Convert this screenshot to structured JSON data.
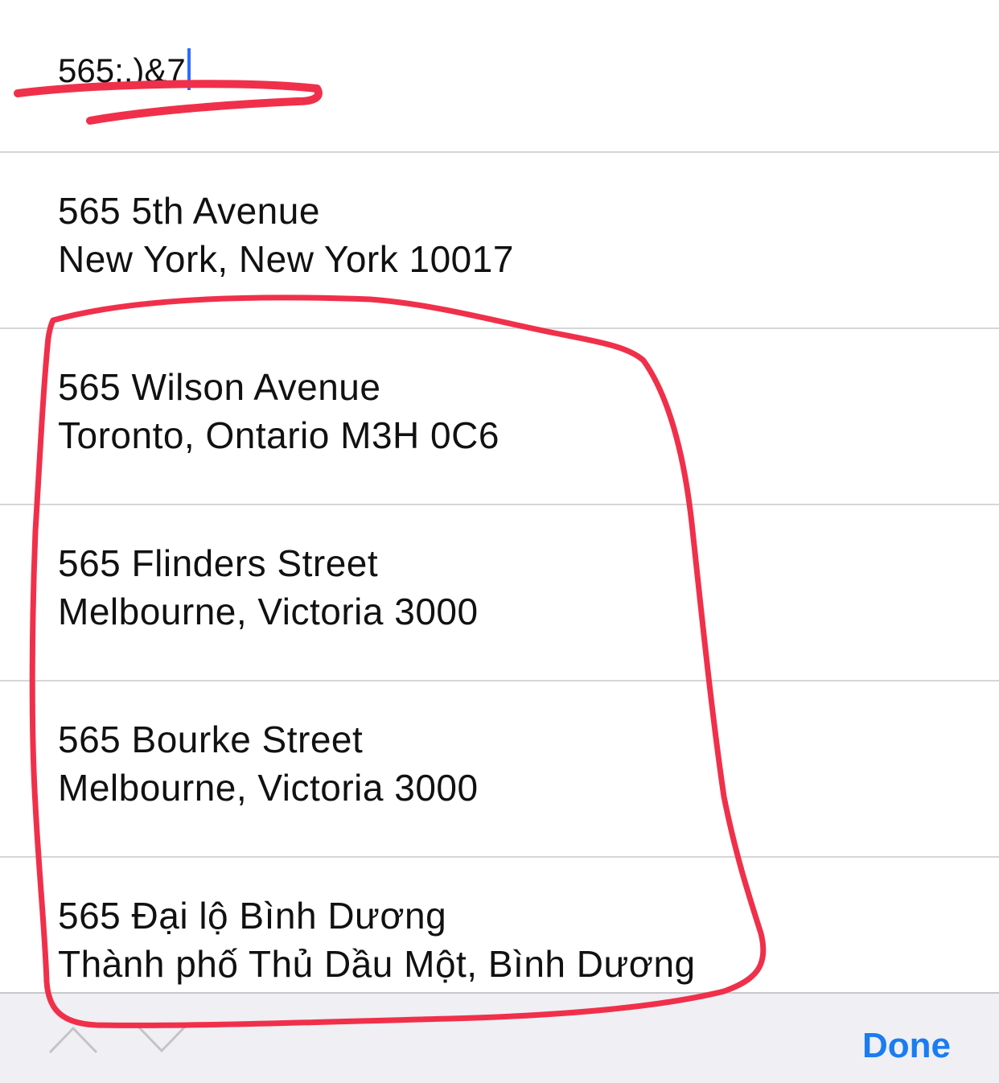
{
  "search": {
    "value": "565;,)&7"
  },
  "suggestions": [
    {
      "line1": "565 5th Avenue",
      "line2": "New York, New York 10017"
    },
    {
      "line1": "565 Wilson Avenue",
      "line2": "Toronto, Ontario M3H 0C6"
    },
    {
      "line1": "565 Flinders Street",
      "line2": "Melbourne, Victoria 3000"
    },
    {
      "line1": "565 Bourke Street",
      "line2": "Melbourne, Victoria 3000"
    },
    {
      "line1": "565 Đại lộ Bình Dương",
      "line2": "Thành phố Thủ Dầu Một, Bình Dương"
    }
  ],
  "toolbar": {
    "prev_icon": "chevron-up-icon",
    "next_icon": "chevron-down-icon",
    "done_label": "Done"
  },
  "colors": {
    "accent": "#1a7cf0",
    "annotation": "#f0304a",
    "caret": "#2f6bff"
  }
}
